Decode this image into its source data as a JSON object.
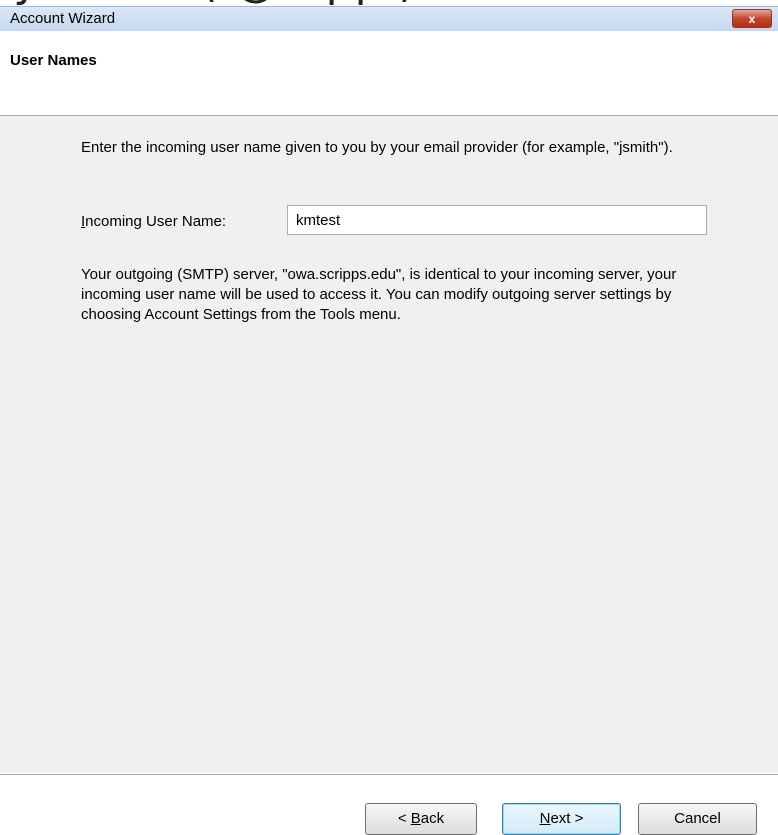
{
  "window": {
    "title": "Account Wizard",
    "close_label": "x"
  },
  "page": {
    "title": "User Names",
    "instruction": "Enter the incoming user name given to you by your email provider (for example, \"jsmith\").",
    "field": {
      "label_mnemonic": "I",
      "label_rest": "ncoming User Name:",
      "value": "kmtest"
    },
    "note": "Your outgoing (SMTP) server, \"owa.scripps.edu\", is identical to your incoming server, your incoming user name will be used to access it. You can modify outgoing server settings by choosing Account Settings from the Tools menu."
  },
  "buttons": {
    "back_prefix": "< ",
    "back_mnemonic": "B",
    "back_rest": "ack",
    "next_mnemonic": "N",
    "next_rest": "ext >",
    "cancel": "Cancel"
  }
}
